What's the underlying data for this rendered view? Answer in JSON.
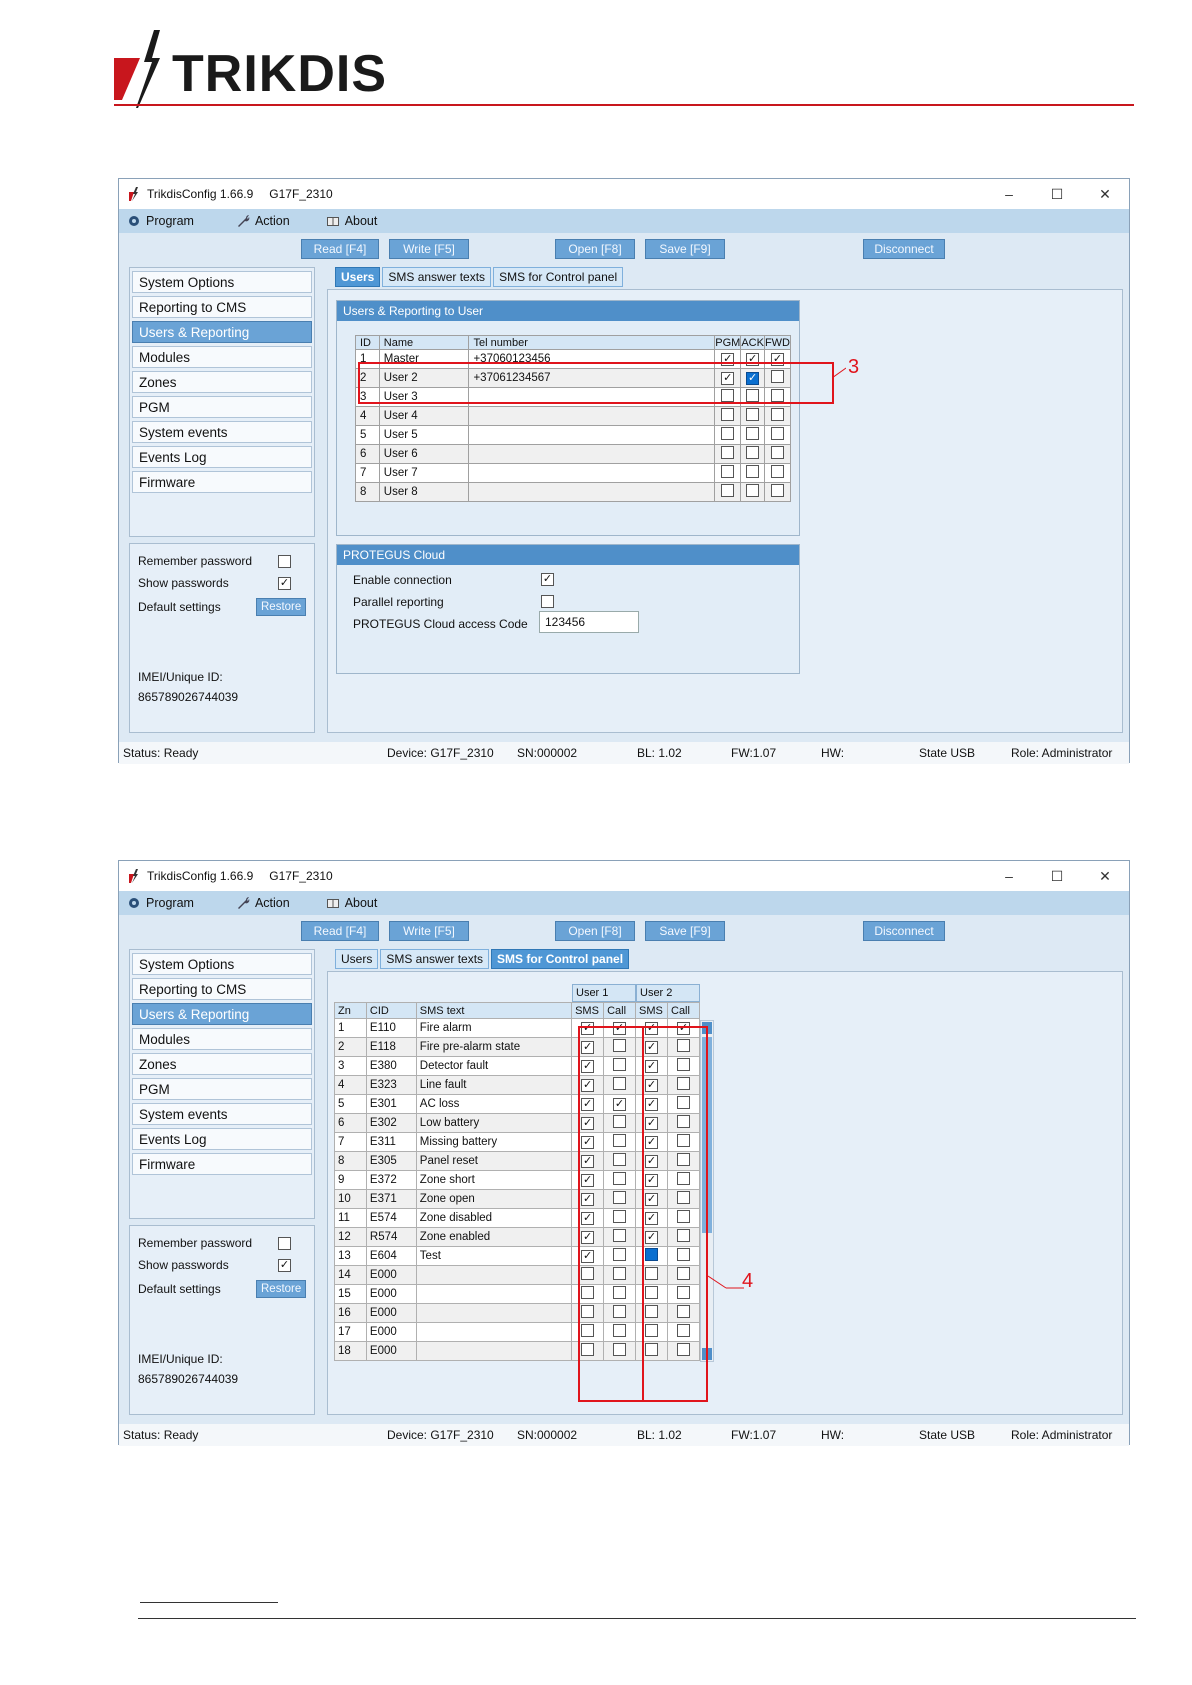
{
  "logo": {
    "text": "TRIKDIS"
  },
  "window": {
    "app_title": "TrikdisConfig 1.66.9",
    "device_title": "G17F_2310",
    "min_glyph": "–",
    "max_glyph": "☐",
    "close_glyph": "✕"
  },
  "menu": {
    "program": "Program",
    "action": "Action",
    "about": "About"
  },
  "toolbar": {
    "read": "Read [F4]",
    "write": "Write [F5]",
    "open": "Open [F8]",
    "save": "Save [F9]",
    "disconnect": "Disconnect"
  },
  "nav": [
    "System Options",
    "Reporting to CMS",
    "Users & Reporting",
    "Modules",
    "Zones",
    "PGM",
    "System events",
    "Events Log",
    "Firmware"
  ],
  "options": {
    "remember_password": "Remember password",
    "show_passwords": "Show passwords",
    "default_settings": "Default settings",
    "restore": "Restore",
    "imei_label": "IMEI/Unique ID:",
    "imei_value": "865789026744039"
  },
  "tabs": {
    "users": "Users",
    "sms_answer": "SMS answer texts",
    "sms_control": "SMS for Control panel"
  },
  "users_panel": {
    "title": "Users & Reporting to User",
    "headers": [
      "ID",
      "Name",
      "Tel number",
      "PGM",
      "ACK",
      "FWD"
    ],
    "rows": [
      {
        "id": "1",
        "name": "Master",
        "tel": "+37060123456"
      },
      {
        "id": "2",
        "name": "User 2",
        "tel": "+37061234567"
      },
      {
        "id": "3",
        "name": "User 3",
        "tel": ""
      },
      {
        "id": "4",
        "name": "User 4",
        "tel": ""
      },
      {
        "id": "5",
        "name": "User 5",
        "tel": ""
      },
      {
        "id": "6",
        "name": "User 6",
        "tel": ""
      },
      {
        "id": "7",
        "name": "User 7",
        "tel": ""
      },
      {
        "id": "8",
        "name": "User 8",
        "tel": ""
      }
    ]
  },
  "protegus": {
    "title": "PROTEGUS Cloud",
    "enable": "Enable connection",
    "parallel": "Parallel reporting",
    "access_label": "PROTEGUS Cloud access Code",
    "access_code": "123456"
  },
  "sms_panel": {
    "user1": "User 1",
    "user2": "User 2",
    "headers": [
      "Zn",
      "CID",
      "SMS text",
      "SMS",
      "Call",
      "SMS",
      "Call"
    ],
    "rows": [
      {
        "zn": "1",
        "cid": "E110",
        "text": "Fire alarm"
      },
      {
        "zn": "2",
        "cid": "E118",
        "text": "Fire pre-alarm state"
      },
      {
        "zn": "3",
        "cid": "E380",
        "text": "Detector fault"
      },
      {
        "zn": "4",
        "cid": "E323",
        "text": "Line fault"
      },
      {
        "zn": "5",
        "cid": "E301",
        "text": "AC loss"
      },
      {
        "zn": "6",
        "cid": "E302",
        "text": "Low battery"
      },
      {
        "zn": "7",
        "cid": "E311",
        "text": "Missing battery"
      },
      {
        "zn": "8",
        "cid": "E305",
        "text": "Panel reset"
      },
      {
        "zn": "9",
        "cid": "E372",
        "text": "Zone short"
      },
      {
        "zn": "10",
        "cid": "E371",
        "text": "Zone open"
      },
      {
        "zn": "11",
        "cid": "E574",
        "text": "Zone disabled"
      },
      {
        "zn": "12",
        "cid": "R574",
        "text": "Zone enabled"
      },
      {
        "zn": "13",
        "cid": "E604",
        "text": "Test"
      },
      {
        "zn": "14",
        "cid": "E000",
        "text": ""
      },
      {
        "zn": "15",
        "cid": "E000",
        "text": ""
      },
      {
        "zn": "16",
        "cid": "E000",
        "text": ""
      },
      {
        "zn": "17",
        "cid": "E000",
        "text": ""
      },
      {
        "zn": "18",
        "cid": "E000",
        "text": ""
      }
    ]
  },
  "status": {
    "status": "Status: Ready",
    "device": "Device: G17F_2310",
    "sn": "SN:000002",
    "bl": "BL: 1.02",
    "fw": "FW:1.07",
    "hw": "HW:",
    "state": "State USB",
    "role": "Role: Administrator"
  },
  "callouts": {
    "a": "3",
    "b": "4"
  },
  "colors": {
    "accent": "#6aa3d6",
    "brand_red": "#c8161d",
    "callout_red": "#e0141c"
  },
  "checks": {
    "users": [
      [
        1,
        1,
        1
      ],
      [
        1,
        1,
        0
      ],
      [
        0,
        0,
        0
      ],
      [
        0,
        0,
        0
      ],
      [
        0,
        0,
        0
      ],
      [
        0,
        0,
        0
      ],
      [
        0,
        0,
        0
      ],
      [
        0,
        0,
        0
      ]
    ],
    "sms": [
      [
        1,
        1,
        1,
        1
      ],
      [
        1,
        0,
        1,
        0
      ],
      [
        1,
        0,
        1,
        0
      ],
      [
        1,
        0,
        1,
        0
      ],
      [
        1,
        1,
        1,
        0
      ],
      [
        1,
        0,
        1,
        0
      ],
      [
        1,
        0,
        1,
        0
      ],
      [
        1,
        0,
        1,
        0
      ],
      [
        1,
        0,
        1,
        0
      ],
      [
        1,
        0,
        1,
        0
      ],
      [
        1,
        0,
        1,
        0
      ],
      [
        1,
        0,
        1,
        0
      ],
      [
        1,
        0,
        0,
        0
      ],
      [
        0,
        0,
        0,
        0
      ],
      [
        0,
        0,
        0,
        0
      ],
      [
        0,
        0,
        0,
        0
      ],
      [
        0,
        0,
        0,
        0
      ],
      [
        0,
        0,
        0,
        0
      ]
    ],
    "protegus_enable": true,
    "protegus_parallel": false,
    "remember_password": false,
    "show_passwords": true
  }
}
